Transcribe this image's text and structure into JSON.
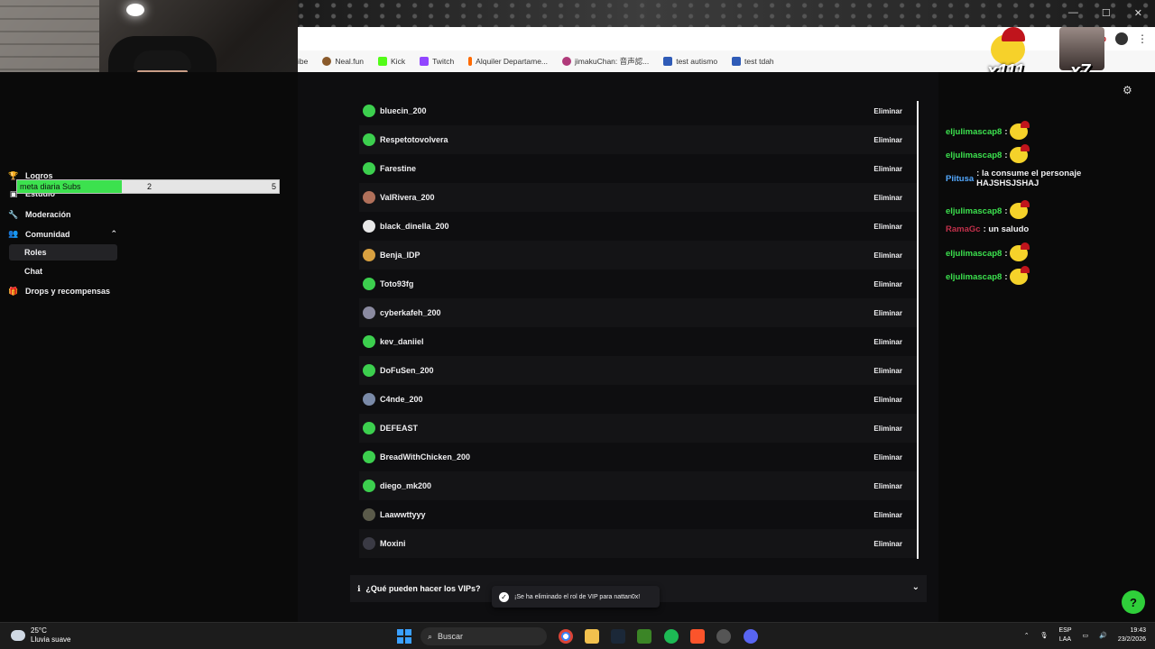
{
  "webcam": {
    "label": "streamer-webcam"
  },
  "browser": {
    "window_controls": [
      "—",
      "☐",
      "✕"
    ],
    "bookmarks": [
      {
        "label": "ibe",
        "color": "#ff0000"
      },
      {
        "label": "Neal.fun",
        "color": "#8a5a2b"
      },
      {
        "label": "Kick",
        "color": "#53fc18"
      },
      {
        "label": "Twitch",
        "color": "#9146ff"
      },
      {
        "label": "Alquiler Departame...",
        "color": "#ff6a00"
      },
      {
        "label": "jimakuChan: 音声認...",
        "color": "#b03a7a"
      },
      {
        "label": "test autismo",
        "color": "#2f5bb7"
      },
      {
        "label": "test tdah",
        "color": "#2f5bb7"
      }
    ]
  },
  "overlay": {
    "emote1_count": "x111",
    "emote2_count": "x7"
  },
  "goal": {
    "label": "meta diaria Subs",
    "current": "2",
    "target": "5",
    "progress": 0.4
  },
  "sidebar": {
    "logros": "Logros",
    "estudio": "Estudio",
    "moderacion": "Moderación",
    "comunidad": "Comunidad",
    "roles": "Roles",
    "chat": "Chat",
    "drops": "Drops y recompensas"
  },
  "vip_list": {
    "remove_label": "Eliminar",
    "users": [
      {
        "name": "bluecin_200",
        "color": "#3ccf4e"
      },
      {
        "name": "Respetotovolvera",
        "color": "#3ccf4e"
      },
      {
        "name": "Farestine",
        "color": "#3ccf4e"
      },
      {
        "name": "ValRivera_200",
        "color": "#b0705a"
      },
      {
        "name": "black_dinella_200",
        "color": "#e8e8e8"
      },
      {
        "name": "Benja_IDP",
        "color": "#d8a040"
      },
      {
        "name": "Toto93fg",
        "color": "#3ccf4e"
      },
      {
        "name": "cyberkafeh_200",
        "color": "#8a8aa0"
      },
      {
        "name": "kev_daniiel",
        "color": "#3ccf4e"
      },
      {
        "name": "DoFuSen_200",
        "color": "#3ccf4e"
      },
      {
        "name": "C4nde_200",
        "color": "#7a8aa8"
      },
      {
        "name": "DEFEAST",
        "color": "#3ccf4e"
      },
      {
        "name": "BreadWithChicken_200",
        "color": "#3ccf4e"
      },
      {
        "name": "diego_mk200",
        "color": "#3ccf4e"
      },
      {
        "name": "Laawwttyyy",
        "color": "#5a5a4a"
      },
      {
        "name": "Moxini",
        "color": "#3a3a44"
      }
    ]
  },
  "faq": {
    "label": "¿Qué pueden hacer los VIPs?"
  },
  "toast": {
    "message": "¡Se ha eliminado el rol de VIP para nattan0x!"
  },
  "chat": {
    "messages": [
      {
        "user": "eljulimascap8",
        "text": ":",
        "emote": true
      },
      {
        "user": "eljulimascap8",
        "text": ":",
        "emote": true
      },
      {
        "user": "Piitusa",
        "text": ": la consume el personaje HAJSHSJSHAJ",
        "emote": false
      },
      {
        "user": "eljulimascap8",
        "text": ":",
        "emote": true
      },
      {
        "user": "RamaGc",
        "text": ": un saludo",
        "emote": false
      },
      {
        "user": "eljulimascap8",
        "text": ":",
        "emote": true
      },
      {
        "user": "eljulimascap8",
        "text": ":",
        "emote": true
      }
    ]
  },
  "taskbar": {
    "temp": "25°C",
    "weather": "Lluvia suave",
    "search": "Buscar",
    "lang1": "ESP",
    "lang2": "LAA",
    "time": "19:43",
    "date": "23/2/2026"
  }
}
